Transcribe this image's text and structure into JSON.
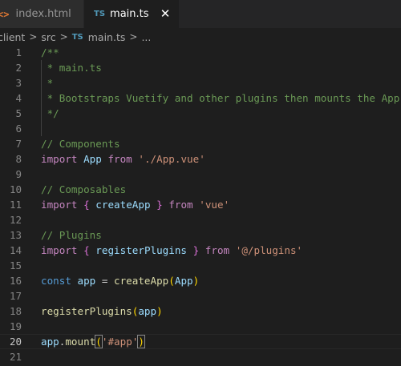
{
  "tabs": [
    {
      "icon": "<>",
      "label": "index.html",
      "active": false
    },
    {
      "icon": "TS",
      "label": "main.ts",
      "active": true,
      "close": "✕"
    }
  ],
  "breadcrumb": {
    "items": [
      "client",
      "src",
      "main.ts",
      "..."
    ],
    "separator": ">",
    "file_icon": "TS"
  },
  "editor": {
    "active_line": 20,
    "lines": [
      {
        "n": "1",
        "tokens": [
          [
            "comment",
            "/**"
          ]
        ]
      },
      {
        "n": "2",
        "tokens": [
          [
            "comment",
            " * main.ts"
          ]
        ]
      },
      {
        "n": "3",
        "tokens": [
          [
            "comment",
            " *"
          ]
        ]
      },
      {
        "n": "4",
        "tokens": [
          [
            "comment",
            " * Bootstraps Vuetify and other plugins then mounts the App"
          ]
        ]
      },
      {
        "n": "5",
        "tokens": [
          [
            "comment",
            " */"
          ]
        ]
      },
      {
        "n": "6",
        "tokens": []
      },
      {
        "n": "7",
        "tokens": [
          [
            "comment",
            "// Components"
          ]
        ]
      },
      {
        "n": "8",
        "tokens": [
          [
            "kw",
            "import"
          ],
          [
            "plain",
            " "
          ],
          [
            "var",
            "App"
          ],
          [
            "plain",
            " "
          ],
          [
            "kw",
            "from"
          ],
          [
            "plain",
            " "
          ],
          [
            "str",
            "'./App.vue'"
          ]
        ]
      },
      {
        "n": "9",
        "tokens": []
      },
      {
        "n": "10",
        "tokens": [
          [
            "comment",
            "// Composables"
          ]
        ]
      },
      {
        "n": "11",
        "tokens": [
          [
            "kw",
            "import"
          ],
          [
            "plain",
            " "
          ],
          [
            "brace",
            "{"
          ],
          [
            "plain",
            " "
          ],
          [
            "var",
            "createApp"
          ],
          [
            "plain",
            " "
          ],
          [
            "brace",
            "}"
          ],
          [
            "plain",
            " "
          ],
          [
            "kw",
            "from"
          ],
          [
            "plain",
            " "
          ],
          [
            "str",
            "'vue'"
          ]
        ]
      },
      {
        "n": "12",
        "tokens": []
      },
      {
        "n": "13",
        "tokens": [
          [
            "comment",
            "// Plugins"
          ]
        ]
      },
      {
        "n": "14",
        "tokens": [
          [
            "kw",
            "import"
          ],
          [
            "plain",
            " "
          ],
          [
            "brace",
            "{"
          ],
          [
            "plain",
            " "
          ],
          [
            "var",
            "registerPlugins"
          ],
          [
            "plain",
            " "
          ],
          [
            "brace",
            "}"
          ],
          [
            "plain",
            " "
          ],
          [
            "kw",
            "from"
          ],
          [
            "plain",
            " "
          ],
          [
            "str",
            "'@/plugins'"
          ]
        ]
      },
      {
        "n": "15",
        "tokens": []
      },
      {
        "n": "16",
        "tokens": [
          [
            "decl",
            "const"
          ],
          [
            "plain",
            " "
          ],
          [
            "var",
            "app"
          ],
          [
            "plain",
            " = "
          ],
          [
            "fn",
            "createApp"
          ],
          [
            "paren",
            "("
          ],
          [
            "var",
            "App"
          ],
          [
            "paren",
            ")"
          ]
        ]
      },
      {
        "n": "17",
        "tokens": []
      },
      {
        "n": "18",
        "tokens": [
          [
            "fn",
            "registerPlugins"
          ],
          [
            "paren",
            "("
          ],
          [
            "var",
            "app"
          ],
          [
            "paren",
            ")"
          ]
        ]
      },
      {
        "n": "19",
        "tokens": []
      },
      {
        "n": "20",
        "tokens": [
          [
            "var",
            "app"
          ],
          [
            "plain",
            "."
          ],
          [
            "fn",
            "mount"
          ],
          [
            "paren-match",
            "("
          ],
          [
            "str",
            "'#app'"
          ],
          [
            "paren-match",
            ")"
          ]
        ]
      },
      {
        "n": "21",
        "tokens": []
      }
    ]
  },
  "colors": {
    "background": "#1e1e1e",
    "comment": "#6a9955",
    "keyword": "#c586c0",
    "declaration": "#569cd6",
    "variable": "#9cdcfe",
    "function": "#dcdcaa",
    "string": "#ce9178",
    "brace": "#da70d6",
    "paren": "#ffd700",
    "ts_icon": "#519aba",
    "html_icon": "#e37933"
  }
}
